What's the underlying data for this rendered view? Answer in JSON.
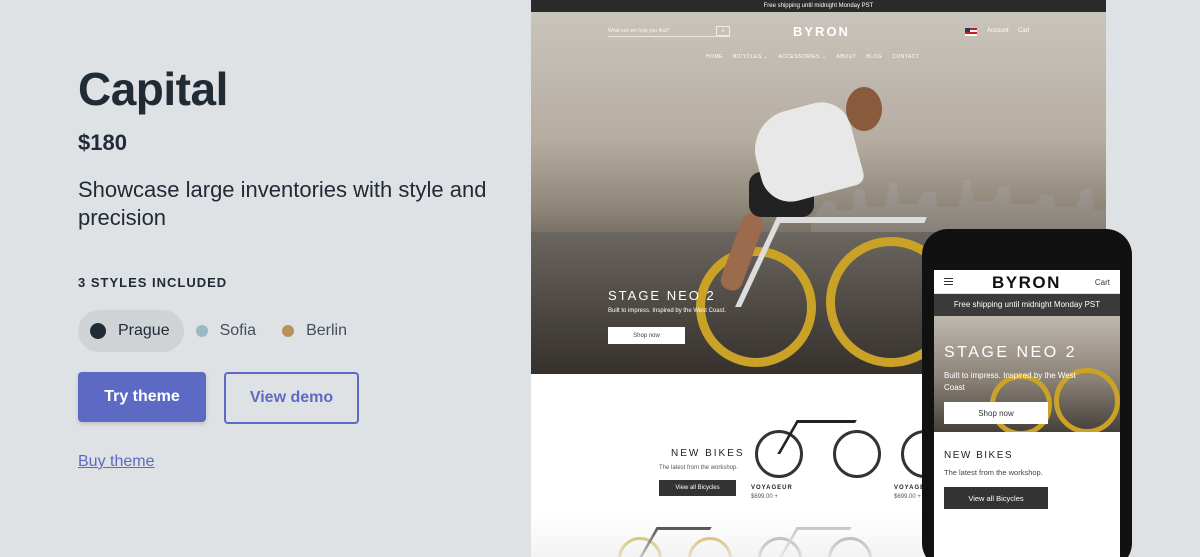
{
  "theme": {
    "name": "Capital",
    "price": "$180",
    "description": "Showcase large inventories with style and precision",
    "styles_heading": "3 STYLES INCLUDED",
    "styles": [
      {
        "label": "Prague",
        "color": "#212b36",
        "selected": true
      },
      {
        "label": "Sofia",
        "color": "#9bb9c4",
        "selected": false
      },
      {
        "label": "Berlin",
        "color": "#b8925a",
        "selected": false
      }
    ],
    "try_label": "Try theme",
    "demo_label": "View demo",
    "buy_label": "Buy theme"
  },
  "colors": {
    "accent": "#5c6ac4",
    "background": "#dfe2e4",
    "text": "#212b36"
  },
  "desktop": {
    "shipping": "Free shipping until midnight Monday PST",
    "search_placeholder": "What can we help you find?",
    "logo": "BYRON",
    "account": "Account",
    "cart": "Cart",
    "nav": [
      "HOME",
      "BICYCLES ⌄",
      "ACCESSORIES ⌄",
      "ABOUT",
      "BLOG",
      "CONTACT"
    ],
    "hero": {
      "heading": "STAGE NEO 2",
      "sub": "Built to impress. Inspired by the West Coast.",
      "button": "Shop now"
    },
    "new_bikes": {
      "heading": "NEW BIKES",
      "sub": "The latest from the workshop.",
      "button": "View all Bicycles"
    },
    "products": [
      {
        "name": "VOYAGEUR",
        "price": "$699.00 +"
      },
      {
        "name": "VOYAGE",
        "price": "$699.00 +"
      }
    ]
  },
  "mobile": {
    "logo": "BYRON",
    "cart": "Cart",
    "shipping": "Free shipping until midnight Monday PST",
    "hero": {
      "heading": "STAGE NEO 2",
      "sub": "Built to impress. Inspired by the West Coast",
      "button": "Shop now"
    },
    "new_bikes": {
      "heading": "NEW BIKES",
      "sub": "The latest from the workshop.",
      "button": "View all Bicycles"
    }
  }
}
